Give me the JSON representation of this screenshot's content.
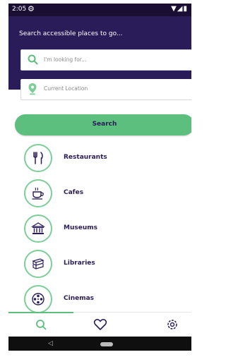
{
  "status_bar": {
    "time": "2:05"
  },
  "header": {
    "prompt": "Search accessible places to go..."
  },
  "search_input": {
    "placeholder": "I'm looking for..."
  },
  "location_input": {
    "placeholder": "Current Location"
  },
  "search_button": {
    "label": "Search"
  },
  "categories": [
    {
      "label": "Restaurants",
      "icon": "fork-knife-icon"
    },
    {
      "label": "Cafes",
      "icon": "coffee-cup-icon"
    },
    {
      "label": "Museums",
      "icon": "museum-icon"
    },
    {
      "label": "Libraries",
      "icon": "books-icon"
    },
    {
      "label": "Cinemas",
      "icon": "film-reel-icon"
    }
  ],
  "bottom_nav": {
    "items": [
      "search-icon",
      "heart-icon",
      "gear-icon"
    ],
    "active": "search-icon"
  },
  "colors": {
    "header_bg": "#2a1c59",
    "accent": "#5cbf7d",
    "text_dark": "#2a1c59"
  }
}
